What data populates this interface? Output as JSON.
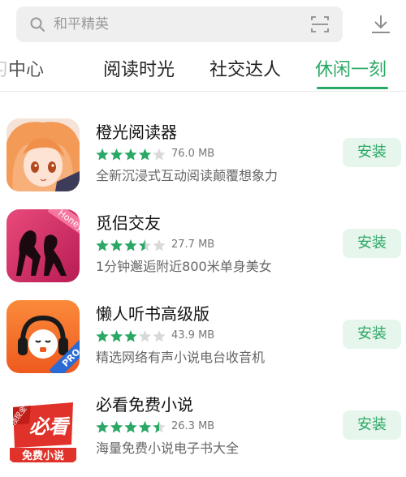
{
  "search": {
    "placeholder": "和平精英"
  },
  "tabs": [
    {
      "label_partial": "习",
      "label_rest": "中心"
    },
    {
      "label": "阅读时光"
    },
    {
      "label": "社交达人"
    },
    {
      "label": "休闲一刻",
      "active": true
    }
  ],
  "apps": [
    {
      "name": "橙光阅读器",
      "rating": 4,
      "size": "76.0 MB",
      "desc": "全新沉浸式互动阅读颠覆想象力",
      "action": "安装",
      "icon": "orange-anime-girl-icon"
    },
    {
      "name": "觅侣交友",
      "rating": 3.5,
      "size": "27.7 MB",
      "desc": "1分钟邂逅附近800米单身美女",
      "action": "安装",
      "icon": "couple-silhouette-icon",
      "icon_badge": "Honey"
    },
    {
      "name": "懒人听书高级版",
      "rating": 3,
      "size": "43.9 MB",
      "desc": "精选网络有声小说电台收音机",
      "action": "安装",
      "icon": "headphones-face-icon",
      "icon_badge": "PRO"
    },
    {
      "name": "必看免费小说",
      "rating": 4.5,
      "size": "26.3 MB",
      "desc": "海量免费小说电子书大全",
      "action": "安装",
      "icon": "book-logo-icon",
      "icon_texts": [
        "领现金",
        "必看",
        "免费小说"
      ]
    }
  ],
  "colors": {
    "accent": "#2aa865",
    "star": "#2aa865",
    "star_empty": "#d9d9d9"
  }
}
